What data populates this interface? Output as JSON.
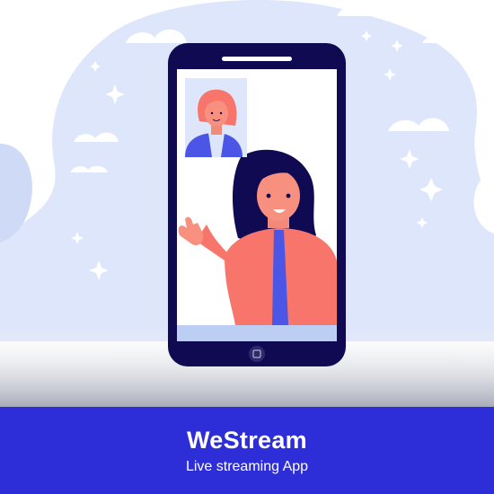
{
  "banner": {
    "title": "WeStream",
    "subtitle": "Live streaming App"
  },
  "colors": {
    "banner": "#2e2ed8",
    "phone": "#0f0a52",
    "background_blob": "#dde6fb",
    "jacket": "#f7756a",
    "accent_blue": "#4b55e6"
  },
  "icons": [
    "home-button-icon",
    "speaker-slot-icon",
    "sparkle-icon",
    "cloud-icon"
  ]
}
